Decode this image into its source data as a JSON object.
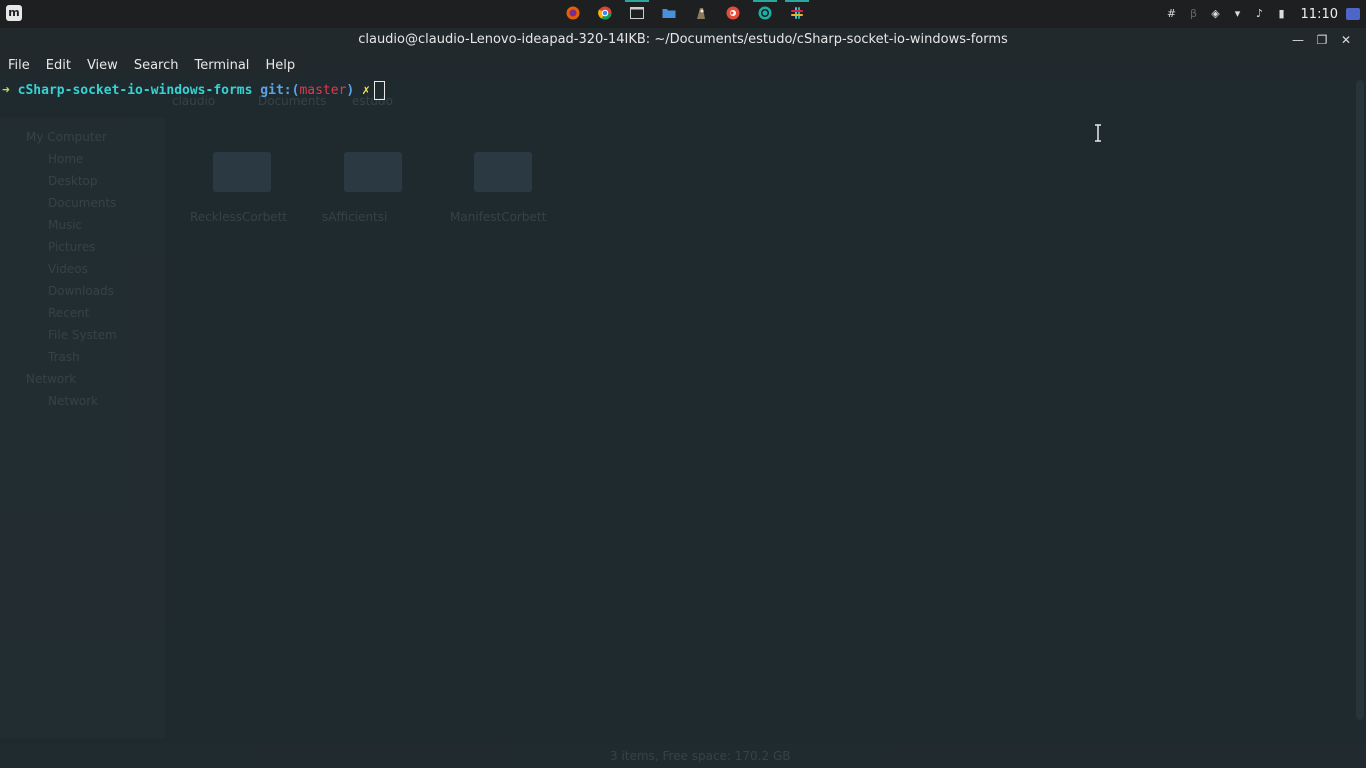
{
  "topbar": {
    "menu_icon_glyph": "m",
    "launchers": [
      {
        "name": "firefox-icon",
        "color": "#e66000"
      },
      {
        "name": "chrome-icon",
        "color": "#db4437"
      },
      {
        "name": "terminal-icon",
        "color": "#cccccc"
      },
      {
        "name": "files-icon",
        "color": "#4a90d9"
      },
      {
        "name": "gimp-icon",
        "color": "#8a7a5a"
      },
      {
        "name": "postman-icon",
        "color": "#e44d3a"
      },
      {
        "name": "vscode-icon",
        "color": "#19b1a6"
      },
      {
        "name": "slack-icon",
        "color": "#e01e5a"
      }
    ],
    "tray": [
      {
        "name": "slack-tray-icon",
        "glyph": "#"
      },
      {
        "name": "bluetooth-icon",
        "glyph": "β"
      },
      {
        "name": "shield-icon",
        "glyph": "◈"
      },
      {
        "name": "wifi-icon",
        "glyph": "▾"
      },
      {
        "name": "music-icon",
        "glyph": "♪"
      },
      {
        "name": "battery-icon",
        "glyph": "▮"
      }
    ],
    "clock": "11:10"
  },
  "window": {
    "title": "claudio@claudio-Lenovo-ideapad-320-14IKB: ~/Documents/estudo/cSharp-socket-io-windows-forms",
    "minimize": "—",
    "maximize": "❐",
    "close": "✕"
  },
  "menubar": {
    "items": [
      "File",
      "Edit",
      "View",
      "Search",
      "Terminal",
      "Help"
    ]
  },
  "terminal": {
    "arrow": "➜",
    "directory": "cSharp-socket-io-windows-forms",
    "git_label": "git:(",
    "branch": "master",
    "git_close": ")",
    "dirty": "✗"
  },
  "ghost": {
    "sidebar_items": [
      "My Computer",
      "Home",
      "Desktop",
      "Documents",
      "Music",
      "Pictures",
      "Videos",
      "Downloads",
      "Recent",
      "File System",
      "Trash",
      "Network",
      "Network"
    ],
    "breadcrumb": [
      "claudio",
      "Documents",
      "estudo"
    ],
    "folders": [
      "RecklessCorbett",
      "sAfficientsi",
      "ManifestCorbett"
    ],
    "status": "3 items, Free space: 170.2 GB"
  },
  "colors": {
    "terminal_bg": "#1f2a2f",
    "prompt_arrow": "#b7e34b",
    "prompt_dir": "#37d2d2",
    "prompt_branch": "#e0384f",
    "prompt_dirty": "#f0e24a"
  }
}
